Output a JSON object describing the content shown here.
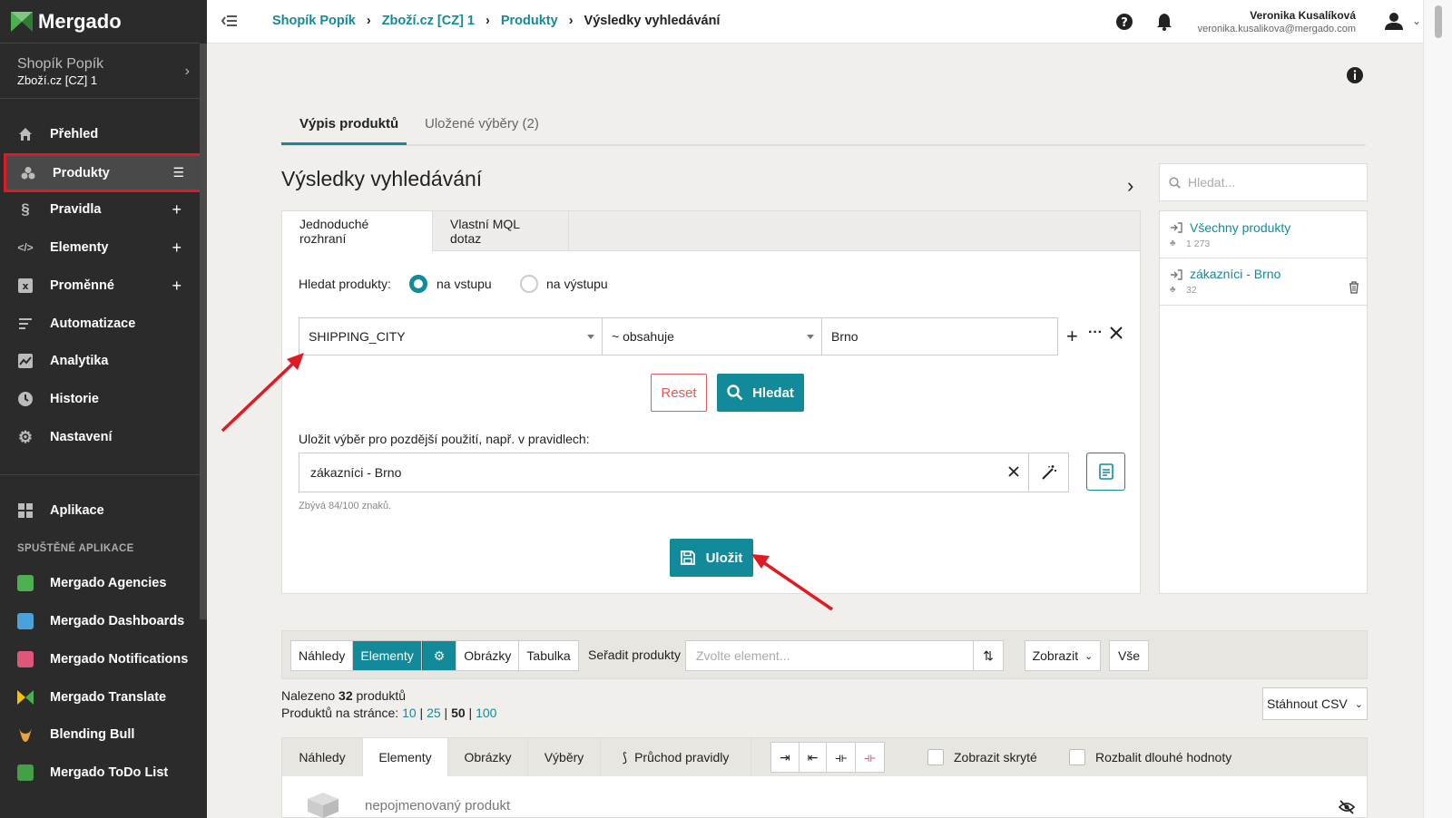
{
  "brand": {
    "name": "Mergado"
  },
  "shop": {
    "name": "Shopík Popík",
    "feed": "Zboží.cz [CZ] 1"
  },
  "nav": [
    {
      "label": "Přehled",
      "icon": "home-icon"
    },
    {
      "label": "Produkty",
      "icon": "products-icon",
      "active": true
    },
    {
      "label": "Pravidla",
      "icon": "section-icon"
    },
    {
      "label": "Elementy",
      "icon": "code-icon"
    },
    {
      "label": "Proměnné",
      "icon": "variable-icon"
    },
    {
      "label": "Automatizace",
      "icon": "automation-icon"
    },
    {
      "label": "Analytika",
      "icon": "chart-icon"
    },
    {
      "label": "Historie",
      "icon": "clock-icon"
    },
    {
      "label": "Nastavení",
      "icon": "gear-icon"
    }
  ],
  "apps_label": "Aplikace",
  "running_label": "SPUŠTĚNÉ APLIKACE",
  "apps": [
    {
      "label": "Mergado Agencies",
      "color": "#4caf50"
    },
    {
      "label": "Mergado Dashboards",
      "color": "#4aa3d8"
    },
    {
      "label": "Mergado Notifications",
      "color": "#e0567a"
    },
    {
      "label": "Mergado Translate",
      "color": "#f5c400"
    },
    {
      "label": "Blending Bull",
      "color": "#e8a33d"
    },
    {
      "label": "Mergado ToDo List",
      "color": "#43a047"
    }
  ],
  "breadcrumb": [
    "Shopík Popík",
    "Zboží.cz [CZ] 1",
    "Produkty",
    "Výsledky vyhledávání"
  ],
  "user": {
    "name": "Veronika Kusalíková",
    "email": "veronika.kusalikova@mergado.com"
  },
  "page": {
    "tabs": [
      "Výpis produktů",
      "Uložené výběry (2)"
    ],
    "title": "Výsledky vyhledávání"
  },
  "query": {
    "tabs": [
      "Jednoduché rozhraní",
      "Vlastní MQL dotaz"
    ],
    "search_label": "Hledat produkty:",
    "radio_in": "na vstupu",
    "radio_out": "na výstupu",
    "field": "SHIPPING_CITY",
    "operator": "~ obsahuje",
    "value": "Brno",
    "reset": "Reset",
    "search": "Hledat",
    "save_label": "Uložit výběr pro pozdější použití, např. v pravidlech:",
    "save_value": "zákazníci - Brno",
    "remaining": "Zbývá 84/100 znaků.",
    "save_button": "Uložit"
  },
  "saved": {
    "search_placeholder": "Hledat...",
    "items": [
      {
        "label": "Všechny produkty",
        "count": "1 273"
      },
      {
        "label": "zákazníci - Brno",
        "count": "32"
      }
    ]
  },
  "toolbar": {
    "views": [
      "Náhledy",
      "Elementy",
      "Obrázky",
      "Tabulka"
    ],
    "sort_label": "Seřadit produkty",
    "sort_placeholder": "Zvolte element...",
    "show": "Zobrazit",
    "all": "Vše"
  },
  "results": {
    "found_prefix": "Nalezeno",
    "found_count": "32",
    "found_suffix": "produktů",
    "per_page_label": "Produktů na stránce:",
    "per_page": [
      "10",
      "25",
      "50",
      "100"
    ],
    "per_page_selected": "50",
    "download": "Stáhnout CSV"
  },
  "detail_tabs": {
    "tabs": [
      "Náhledy",
      "Elementy",
      "Obrázky",
      "Výběry",
      "Průchod pravidly"
    ],
    "show_hidden": "Zobrazit skryté",
    "expand_long": "Rozbalit dlouhé hodnoty"
  },
  "product": {
    "name": "nepojmenovaný produkt"
  },
  "colors": {
    "accent": "#138a99",
    "sidebar": "#2b2b2b",
    "highlight": "#e01a22"
  }
}
